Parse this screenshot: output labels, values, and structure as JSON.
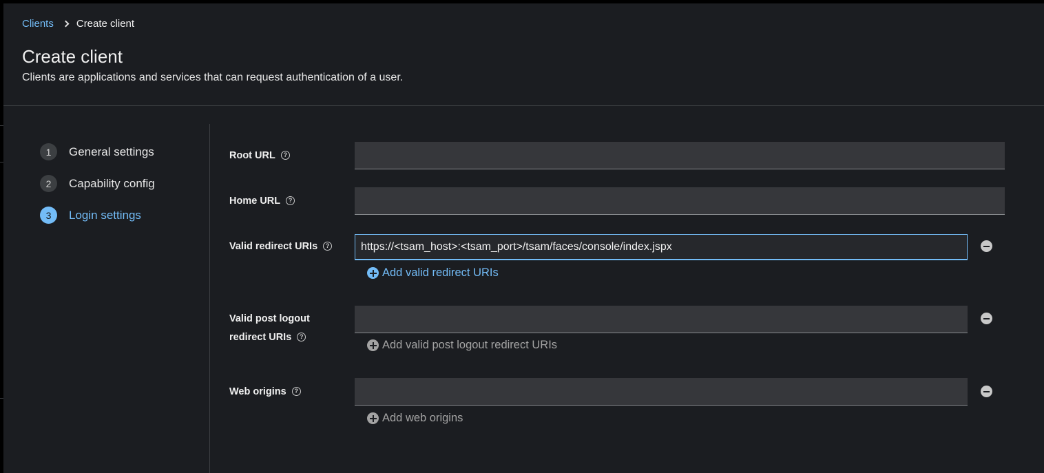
{
  "breadcrumb": {
    "parent": "Clients",
    "current": "Create client"
  },
  "header": {
    "title": "Create client",
    "description": "Clients are applications and services that can request authentication of a user."
  },
  "wizard": {
    "steps": [
      {
        "number": "1",
        "label": "General settings"
      },
      {
        "number": "2",
        "label": "Capability config"
      },
      {
        "number": "3",
        "label": "Login settings"
      }
    ],
    "active_step": "3"
  },
  "form": {
    "root_url": {
      "label": "Root URL",
      "value": ""
    },
    "home_url": {
      "label": "Home URL",
      "value": ""
    },
    "valid_redirect_uris": {
      "label": "Valid redirect URIs",
      "value": "https://<tsam_host>:<tsam_port>/tsam/faces/console/index.jspx",
      "add_label": "Add valid redirect URIs"
    },
    "valid_post_logout": {
      "label_line1": "Valid post logout",
      "label_line2": "redirect URIs",
      "value": "",
      "add_label": "Add valid post logout redirect URIs"
    },
    "web_origins": {
      "label": "Web origins",
      "value": "",
      "add_label": "Add web origins"
    }
  },
  "colors": {
    "background": "#1b1d21",
    "accent": "#73bcf7",
    "input_bg": "#36373b",
    "disabled_text": "#a3a3a3"
  }
}
